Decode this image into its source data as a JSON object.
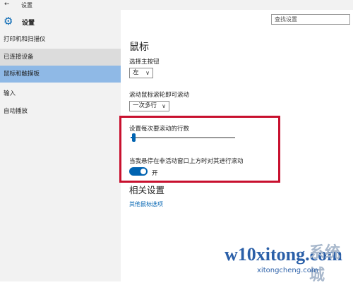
{
  "window": {
    "back_glyph": "←",
    "title": "设置"
  },
  "app": {
    "icon": "gear-icon",
    "name": "设置"
  },
  "search": {
    "placeholder": "查找设置"
  },
  "sidebar": {
    "items": [
      {
        "label": "打印机和扫描仪",
        "state": "normal"
      },
      {
        "label": "已连接设备",
        "state": "hover"
      },
      {
        "label": "鼠标和触摸板",
        "state": "selected"
      },
      {
        "label": "输入",
        "state": "normal"
      },
      {
        "label": "自动播放",
        "state": "normal"
      }
    ]
  },
  "main": {
    "heading": "鼠标",
    "primary_button": {
      "label": "选择主按钮",
      "value": "左"
    },
    "scroll_mode": {
      "label": "滚动鼠标滚轮即可滚动",
      "value": "一次多行"
    },
    "scroll_lines": {
      "label": "设置每次要滚动的行数",
      "value_fraction": 0.03
    },
    "inactive_scroll": {
      "label": "当我悬停在非活动窗口上方时对其进行滚动",
      "toggle_label": "开",
      "on": true
    },
    "related_heading": "相关设置",
    "related_link": "其他鼠标选项"
  },
  "watermark": {
    "logo": "w10xitong.com",
    "cn": "系统城",
    "sub": "xitongcheng.com"
  },
  "colors": {
    "accent": "#0063b1",
    "highlight": "#c8102e",
    "sidebar_bg": "#f2f2f2",
    "selected_bg": "#8fb9e6"
  }
}
